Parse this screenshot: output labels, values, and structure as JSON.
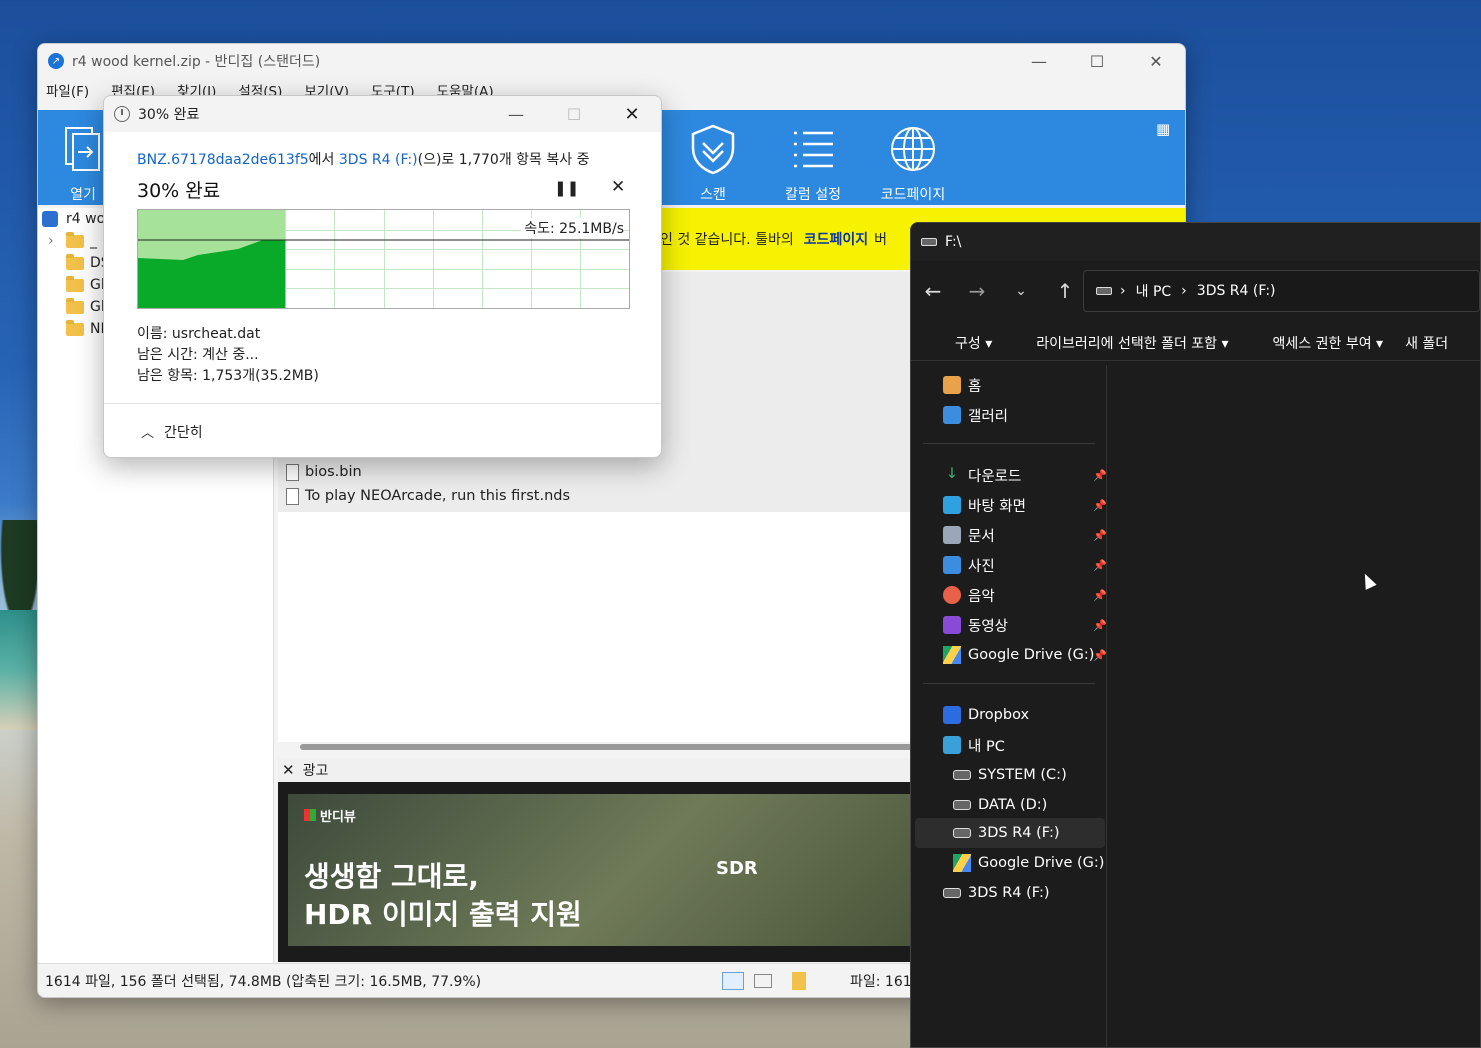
{
  "bandizip": {
    "title": "r4 wood kernel.zip - 반디집 (스탠더드)",
    "app_icon": "bandizip-icon",
    "menu": [
      "파일(F)",
      "편집(E)",
      "찾기(I)",
      "설정(S)",
      "보기(V)",
      "도구(T)",
      "도움말(A)"
    ],
    "ribbon": [
      {
        "label": "열기",
        "icon": "open-icon"
      },
      {
        "label": "스캔",
        "icon": "shield-icon"
      },
      {
        "label": "칼럼 설정",
        "icon": "columns-icon"
      },
      {
        "label": "코드페이지",
        "icon": "globe-icon"
      }
    ],
    "notice_text": "인 것 같습니다. 툴바의",
    "notice_link": "코드페이지",
    "notice_tail": "버",
    "tree": {
      "root": "r4 wo",
      "folders": [
        "_",
        "DS",
        "Gl",
        "Gl",
        "NI"
      ]
    },
    "files": [
      "bios.bin",
      "To play NEOArcade, run this first.nds"
    ],
    "ad_label": "광고",
    "ad_brand": "반디뷰",
    "ad_line1": "생생함 그대로,",
    "ad_line2": "HDR 이미지 출력 지원",
    "ad_badge": "SDR",
    "status_text": "1614 파일, 156 폴더 선택됨, 74.8MB (압축된 크기: 16.5MB, 77.9%)",
    "status_right": "파일: 161"
  },
  "copy_dialog": {
    "title": "30% 완료",
    "source": "BNZ.67178daa2de613f5",
    "mid1": "에서 ",
    "dest": "3DS R4 (F:)",
    "mid2": "(으)로 1,770개 항목 복사 중",
    "percent_text": "30% 완료",
    "progress": 0.3,
    "speed": "속도: 25.1MB/s",
    "name_line": "이름: usrcheat.dat",
    "time_line": "남은 시간: 계산 중...",
    "items_line": "남은 항목: 1,753개(35.2MB)",
    "less_label": "간단히",
    "colors": {
      "fill": "#09a92a",
      "light": "#a7e29a"
    }
  },
  "explorer": {
    "title": "F:\\",
    "breadcrumb": [
      "내 PC",
      "3DS R4 (F:)"
    ],
    "commands": [
      "구성",
      "라이브러리에 선택한 폴더 포함",
      "액세스 권한 부여",
      "새 폴더"
    ],
    "nav_top": [
      {
        "label": "홈",
        "icon": "home-icon"
      },
      {
        "label": "갤러리",
        "icon": "gallery-icon"
      }
    ],
    "nav_pinned": [
      {
        "label": "다운로드",
        "icon": "download-icon"
      },
      {
        "label": "바탕 화면",
        "icon": "desktop-icon"
      },
      {
        "label": "문서",
        "icon": "document-icon"
      },
      {
        "label": "사진",
        "icon": "pictures-icon"
      },
      {
        "label": "음악",
        "icon": "music-icon"
      },
      {
        "label": "동영상",
        "icon": "video-icon"
      },
      {
        "label": "Google Drive (G:)",
        "icon": "google-drive-icon"
      }
    ],
    "nav_bottom": [
      {
        "label": "Dropbox",
        "icon": "dropbox-icon"
      },
      {
        "label": "내 PC",
        "icon": "pc-icon"
      },
      {
        "label": "SYSTEM (C:)",
        "icon": "drive-icon"
      },
      {
        "label": "DATA (D:)",
        "icon": "drive-icon"
      },
      {
        "label": "3DS R4 (F:)",
        "icon": "drive-icon"
      },
      {
        "label": "Google Drive (G:)",
        "icon": "google-drive-icon"
      },
      {
        "label": "3DS R4 (F:)",
        "icon": "drive-icon"
      }
    ]
  }
}
